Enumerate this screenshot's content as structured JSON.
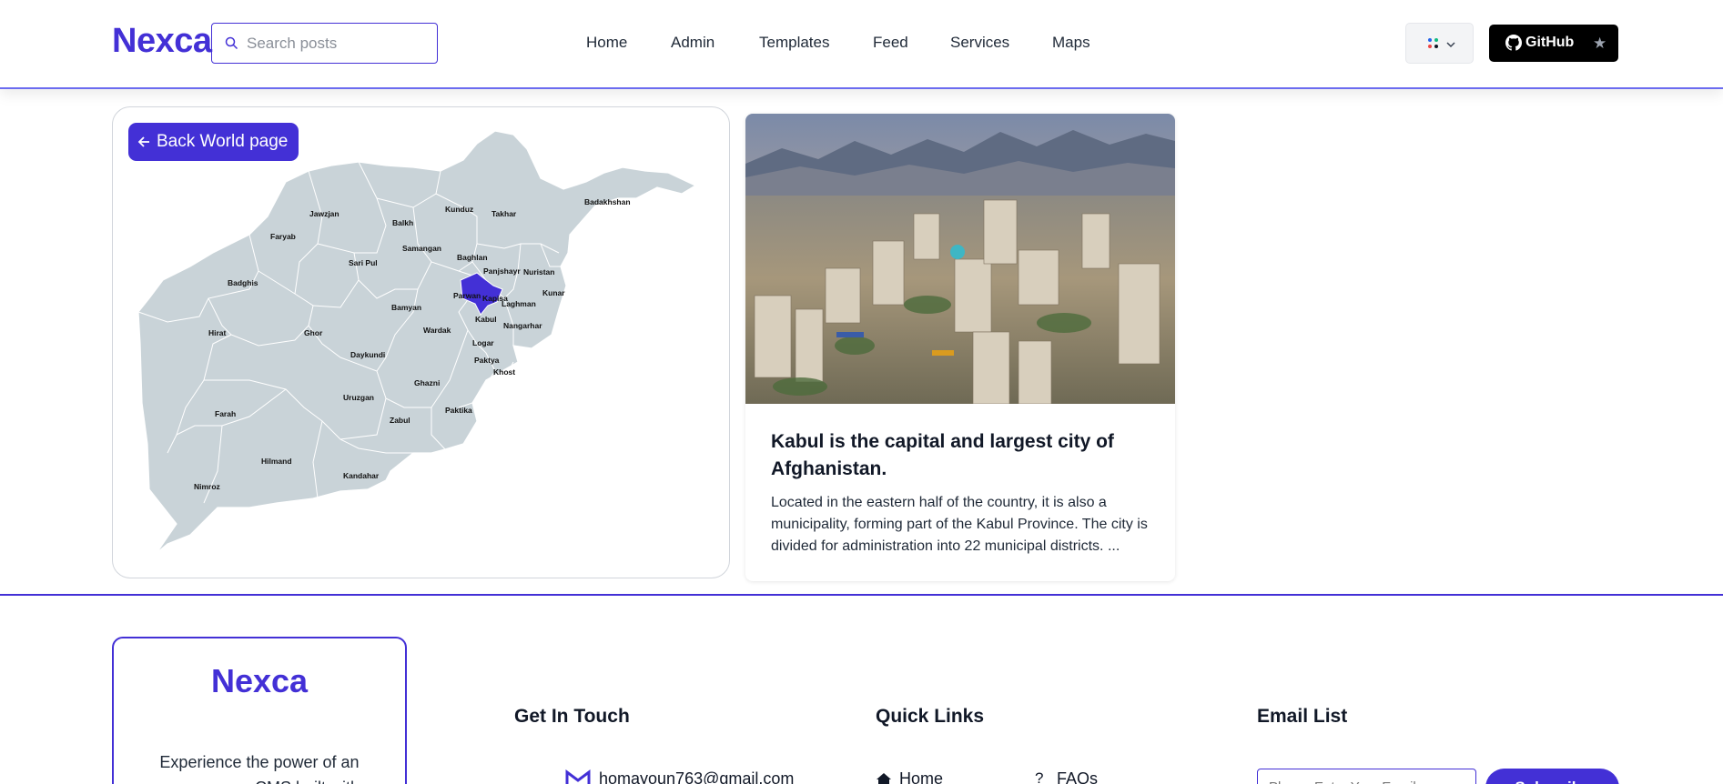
{
  "header": {
    "logo": "Nexca",
    "search_placeholder": "Search posts",
    "nav": [
      "Home",
      "Admin",
      "Templates",
      "Feed",
      "Services",
      "Maps"
    ],
    "github_label": "GitHub",
    "accent": "#4330d6"
  },
  "map": {
    "back_label": "Back World page",
    "selected_province": "Kabul",
    "provinces": [
      "Badakhshan",
      "Jawzjan",
      "Balkh",
      "Kunduz",
      "Takhar",
      "Faryab",
      "Samangan",
      "Baghlan",
      "Sari Pul",
      "Panjshayr",
      "Nuristan",
      "Badghis",
      "Parwan",
      "Kapisa",
      "Kunar",
      "Laghman",
      "Kabul",
      "Nangarhar",
      "Bamyan",
      "Wardak",
      "Hirat",
      "Ghor",
      "Logar",
      "Daykundi",
      "Paktya",
      "Khost",
      "Ghazni",
      "Uruzgan",
      "Paktika",
      "Zabul",
      "Farah",
      "Hilmand",
      "Kandahar",
      "Nimroz"
    ],
    "map_color": "#c9d3d8",
    "selected_color": "#4330d6"
  },
  "article": {
    "title": "Kabul is the capital and largest city of Afghanistan.",
    "body": "Located in the eastern half of the country, it is also a municipality, forming part of the Kabul Province. The city is divided for administration into 22 municipal districts. ..."
  },
  "footer": {
    "brand": "Nexca",
    "tagline": "Experience the power of an open-source CMS built with",
    "get_in_touch": "Get In Touch",
    "email": "homayoun763@gmail.com",
    "quick_links": "Quick Links",
    "links": [
      "Home",
      "FAQs"
    ],
    "email_list": "Email List",
    "email_placeholder": "Please Enter Your Email ...",
    "subscribe_label": "Subscribe"
  }
}
